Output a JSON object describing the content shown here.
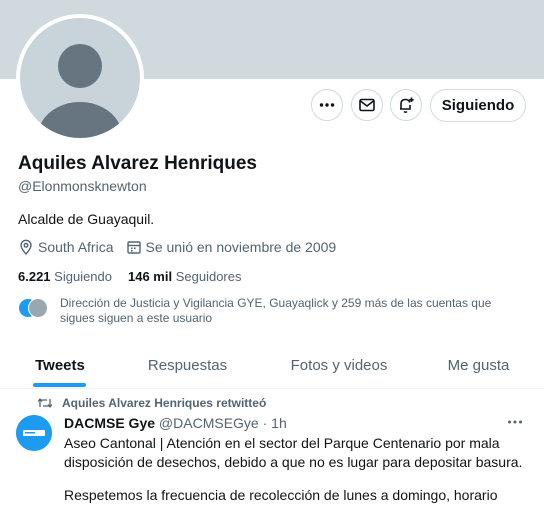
{
  "profile": {
    "name": "Aquiles Alvarez Henriques",
    "handle": "@Elonmonsknewton",
    "bio": "Alcalde de Guayaquil.",
    "location": "South Africa",
    "joined": "Se unió en noviembre de 2009",
    "following_count": "6.221",
    "following_label": "Siguiendo",
    "followers_count": "146 mil",
    "followers_label": "Seguidores",
    "mutual_text": "Dirección de Justicia y Vigilancia GYE, Guayaqlick y 259 más de las cuentas que sigues siguen a este usuario"
  },
  "actions": {
    "follow_label": "Siguiendo"
  },
  "icons": {
    "more": "more-icon",
    "message": "mail-icon",
    "notify": "bell-plus-icon",
    "location": "location-pin-icon",
    "calendar": "calendar-icon",
    "retweet": "retweet-icon"
  },
  "tabs": [
    {
      "label": "Tweets",
      "active": true
    },
    {
      "label": "Respuestas",
      "active": false
    },
    {
      "label": "Fotos y videos",
      "active": false
    },
    {
      "label": "Me gusta",
      "active": false
    }
  ],
  "tweet": {
    "retweet_label": "Aquiles Alvarez Henriques retwitteó",
    "author_name": "DACMSE Gye",
    "author_handle": "@DACMSEGye",
    "separator": "·",
    "time": "1h",
    "text_1": "Aseo Cantonal | Atención en el sector del Parque Centenario por mala disposición de desechos, debido a que no es lugar para depositar basura.",
    "text_2": "Respetemos la frecuencia de recolección de lunes a domingo, horario"
  },
  "colors": {
    "accent": "#1d9bf0",
    "banner": "#cfd9de",
    "secondary_text": "#536471",
    "primary_text": "#0f1419"
  }
}
